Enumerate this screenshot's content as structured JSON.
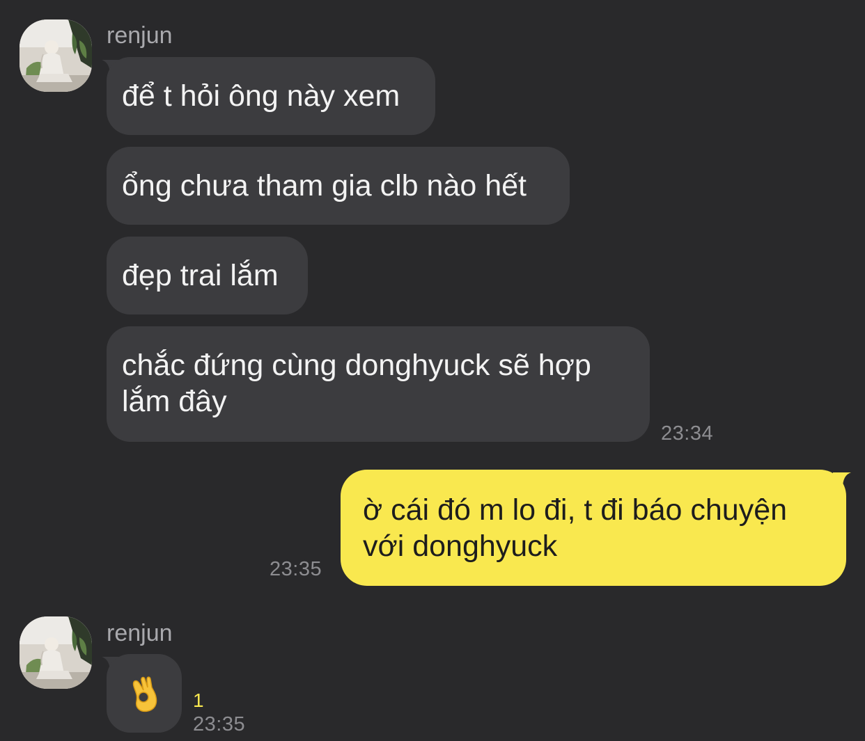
{
  "colors": {
    "background": "#29292b",
    "incoming_bubble": "#3c3c3f",
    "outgoing_bubble": "#f9e84f",
    "timestamp": "#8d8d91",
    "unread": "#f9e84f"
  },
  "messages": [
    {
      "group": 1,
      "sender": "renjun",
      "bubbles": [
        "để t hỏi ông này xem",
        "ổng chưa tham gia clb nào hết",
        "đẹp trai lắm",
        "chắc đứng cùng donghyuck sẽ hợp lắm đây"
      ],
      "time": "23:34"
    },
    {
      "group": 2,
      "sender": "me",
      "bubbles": [
        "ờ cái đó m lo đi, t đi báo chuyện với donghyuck"
      ],
      "time": "23:35"
    },
    {
      "group": 3,
      "sender": "renjun",
      "bubbles": [],
      "emoji": "ok-hand-emoji",
      "unread_count": "1",
      "time": "23:35"
    }
  ],
  "icons": {
    "avatar": "avatar-photo",
    "reaction": "ok-hand-emoji"
  }
}
